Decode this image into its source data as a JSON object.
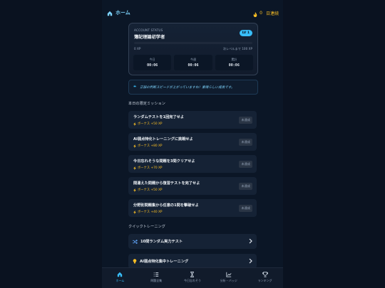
{
  "header": {
    "home_label": "ホーム",
    "streak_count": "0",
    "streak_label": "日連続"
  },
  "account": {
    "caption": "ACCOUNT STATUS",
    "name": "簿記理論初学者",
    "level": "LV 1",
    "xp": "0 XP",
    "next_level": "次レベルまで 100 XP",
    "progress": 0,
    "timers": [
      {
        "label": "今日",
        "value": "00:06"
      },
      {
        "label": "今週",
        "value": "00:06"
      },
      {
        "label": "累計",
        "value": "00:06"
      }
    ]
  },
  "quote": {
    "mark": "❝",
    "text": "正誤の判断スピードが上がっていますね！素晴らしい成長です。"
  },
  "missions_title": "本日の限定ミッション",
  "missions": [
    {
      "title": "ランダムテストを1回完了せよ",
      "bonus": "ボーナス +50 XP",
      "status": "未達成"
    },
    {
      "title": "AI弱点特化トレーニングに挑戦せよ",
      "bonus": "ボーナス +80 XP",
      "status": "未達成"
    },
    {
      "title": "今日忘れそうな問題を3問クリアせよ",
      "bonus": "ボーナス +70 XP",
      "status": "未達成"
    },
    {
      "title": "間違えた問題から復習テストを完了せよ",
      "bonus": "ボーナス +50 XP",
      "status": "未達成"
    },
    {
      "title": "分野別問題集から任意の1問を撃破せよ",
      "bonus": "ボーナス +40 XP",
      "status": "未達成"
    }
  ],
  "quick_title": "クイックトレーニング",
  "quick": [
    {
      "label": "10問ランダム実力テスト",
      "icon": "shuffle-icon"
    },
    {
      "label": "AI弱点特化集中トレーニング",
      "icon": "bulb-icon"
    }
  ],
  "nav": [
    {
      "label": "ホーム",
      "icon": "home-icon"
    },
    {
      "label": "問題全集",
      "icon": "list-icon"
    },
    {
      "label": "今日忘れそう",
      "icon": "hourglass-icon"
    },
    {
      "label": "分析・バッジ",
      "icon": "chart-icon"
    },
    {
      "label": "ランキング",
      "icon": "trophy-icon"
    }
  ],
  "colors": {
    "accent": "#38bdf8",
    "bonus": "#fbbf24",
    "background": "#0b1626"
  }
}
